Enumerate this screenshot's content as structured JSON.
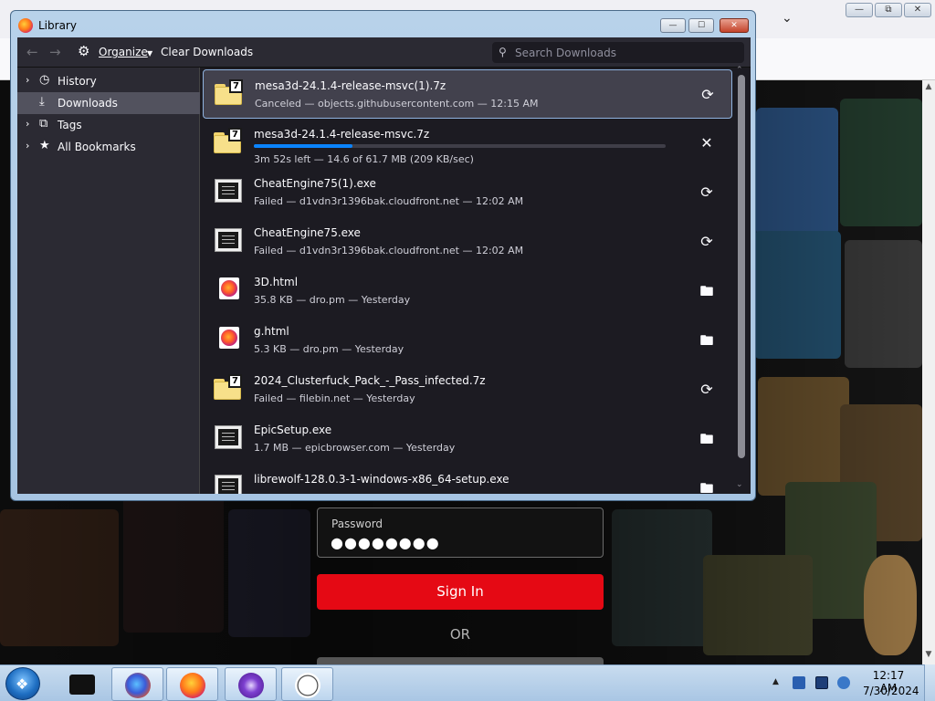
{
  "library": {
    "title": "Library",
    "toolbar": {
      "organize_label": "Organize",
      "clear_label": "Clear Downloads",
      "search_placeholder": "Search Downloads"
    },
    "sidebar": [
      {
        "label": "History",
        "icon": "clock-icon"
      },
      {
        "label": "Downloads",
        "icon": "download-icon",
        "selected": true
      },
      {
        "label": "Tags",
        "icon": "tag-icon"
      },
      {
        "label": "All Bookmarks",
        "icon": "star-icon"
      }
    ],
    "downloads": [
      {
        "name": "mesa3d-24.1.4-release-msvc(1).7z",
        "status": "Canceled — objects.githubusercontent.com — 12:15 AM",
        "icon": "archive",
        "action": "retry"
      },
      {
        "name": "mesa3d-24.1.4-release-msvc.7z",
        "status": "3m 52s left — 14.6 of 61.7 MB (209 KB/sec)",
        "icon": "archive",
        "action": "cancel",
        "progress": 0.24
      },
      {
        "name": "CheatEngine75(1).exe",
        "status": "Failed — d1vdn3r1396bak.cloudfront.net — 12:02 AM",
        "icon": "exe",
        "action": "retry"
      },
      {
        "name": "CheatEngine75.exe",
        "status": "Failed — d1vdn3r1396bak.cloudfront.net — 12:02 AM",
        "icon": "exe",
        "action": "retry"
      },
      {
        "name": "3D.html",
        "status": "35.8 KB — dro.pm — Yesterday",
        "icon": "html",
        "action": "folder"
      },
      {
        "name": "g.html",
        "status": "5.3 KB — dro.pm — Yesterday",
        "icon": "html",
        "action": "folder"
      },
      {
        "name": "2024_Clusterfuck_Pack_-_Pass_infected.7z",
        "status": "Failed — filebin.net — Yesterday",
        "icon": "archive",
        "action": "retry"
      },
      {
        "name": "EpicSetup.exe",
        "status": "1.7 MB — epicbrowser.com — Yesterday",
        "icon": "exe",
        "action": "folder"
      },
      {
        "name": "librewolf-128.0.3-1-windows-x86_64-setup.exe",
        "status": "",
        "icon": "exe",
        "action": "folder"
      }
    ]
  },
  "login": {
    "password_label": "Password",
    "password_value": "●●●●●●●●",
    "signin_label": "Sign In",
    "or_label": "OR"
  },
  "clock": {
    "time": "12:17 AM",
    "date": "7/30/2024"
  },
  "colors": {
    "signin": "#e50914",
    "progress": "#0a84ff",
    "library_bg": "#1c1b22"
  }
}
